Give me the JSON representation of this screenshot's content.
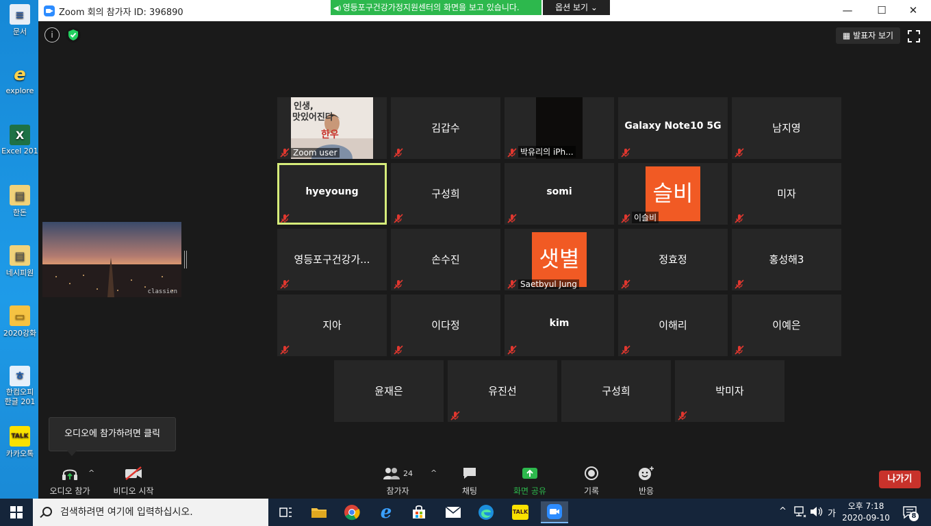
{
  "desktop": {
    "icons": [
      {
        "label": "문서"
      },
      {
        "label": "explore"
      },
      {
        "label": "Excel 201"
      },
      {
        "label": "한돈"
      },
      {
        "label": "네시피원"
      },
      {
        "label": "2020강화"
      },
      {
        "label": "한컴오피 한글 201"
      },
      {
        "label": "카카오톡"
      }
    ]
  },
  "window": {
    "title": "Zoom 회의 참가자 ID: 396890",
    "share_banner": "영등포구건강가정지원센터의 화면을 보고 있습니다.",
    "options_label": "옵션 보기 ⌄",
    "speaker_view_label": "발표자 보기",
    "minimize": "—",
    "maximize": "☐",
    "close": "✕"
  },
  "gallery": {
    "tiles": [
      {
        "name": "",
        "tag": "Zoom user",
        "type": "video-person"
      },
      {
        "name": "김갑수",
        "tag": "",
        "type": "name"
      },
      {
        "name": "",
        "tag": "박유리의 iPh...",
        "type": "video-dark"
      },
      {
        "name": "Galaxy Note10 5G",
        "tag": "",
        "type": "name-bold"
      },
      {
        "name": "남지영",
        "tag": "",
        "type": "name"
      },
      {
        "name": "hyeyoung",
        "tag": "",
        "type": "name-bold-active"
      },
      {
        "name": "구성희",
        "tag": "",
        "type": "name"
      },
      {
        "name": "somi",
        "tag": "",
        "type": "name-bold"
      },
      {
        "name": "",
        "avatar": "슬비",
        "tag": "이슬비",
        "type": "avatar"
      },
      {
        "name": "미자",
        "tag": "",
        "type": "name"
      },
      {
        "name": "영등포구건강가...",
        "tag": "",
        "type": "name"
      },
      {
        "name": "손수진",
        "tag": "",
        "type": "name"
      },
      {
        "name": "",
        "avatar": "샛별",
        "tag": "Saetbyul Jung",
        "type": "avatar"
      },
      {
        "name": "정효정",
        "tag": "",
        "type": "name"
      },
      {
        "name": "홍성해3",
        "tag": "",
        "type": "name"
      },
      {
        "name": "지아",
        "tag": "",
        "type": "name"
      },
      {
        "name": "이다정",
        "tag": "",
        "type": "name"
      },
      {
        "name": "kim",
        "tag": "",
        "type": "name-bold"
      },
      {
        "name": "이해리",
        "tag": "",
        "type": "name"
      },
      {
        "name": "이예은",
        "tag": "",
        "type": "name"
      },
      {
        "name": "윤재은",
        "tag": "",
        "type": "name-nomute"
      },
      {
        "name": "유진선",
        "tag": "",
        "type": "name"
      },
      {
        "name": "구성희",
        "tag": "",
        "type": "name-nomute"
      },
      {
        "name": "박미자",
        "tag": "",
        "type": "name"
      }
    ]
  },
  "video_text": {
    "sign_line1": "인생,",
    "sign_line2": "맛있어진다",
    "sign_line3": "한우"
  },
  "self_view": {
    "watermark": "classien"
  },
  "audio_tooltip": "오디오에 참가하려면 클릭",
  "toolbar": {
    "audio": "오디오 참가",
    "video": "비디오 시작",
    "participants": "참가자",
    "participant_count": "24",
    "chat": "채팅",
    "share": "화면 공유",
    "record": "기록",
    "reactions": "반응",
    "leave": "나가기",
    "caret": "^"
  },
  "taskbar": {
    "search_placeholder": "검색하려면 여기에 입력하십시오.",
    "time": "오후 7:18",
    "date": "2020-09-10",
    "ime": "가",
    "notifications": "8"
  },
  "colors": {
    "share_green": "#2db84d",
    "active_border": "#d6ec7a",
    "avatar_orange": "#f15a24",
    "leave_red": "#c8322b",
    "mute_red": "#e0372f"
  }
}
